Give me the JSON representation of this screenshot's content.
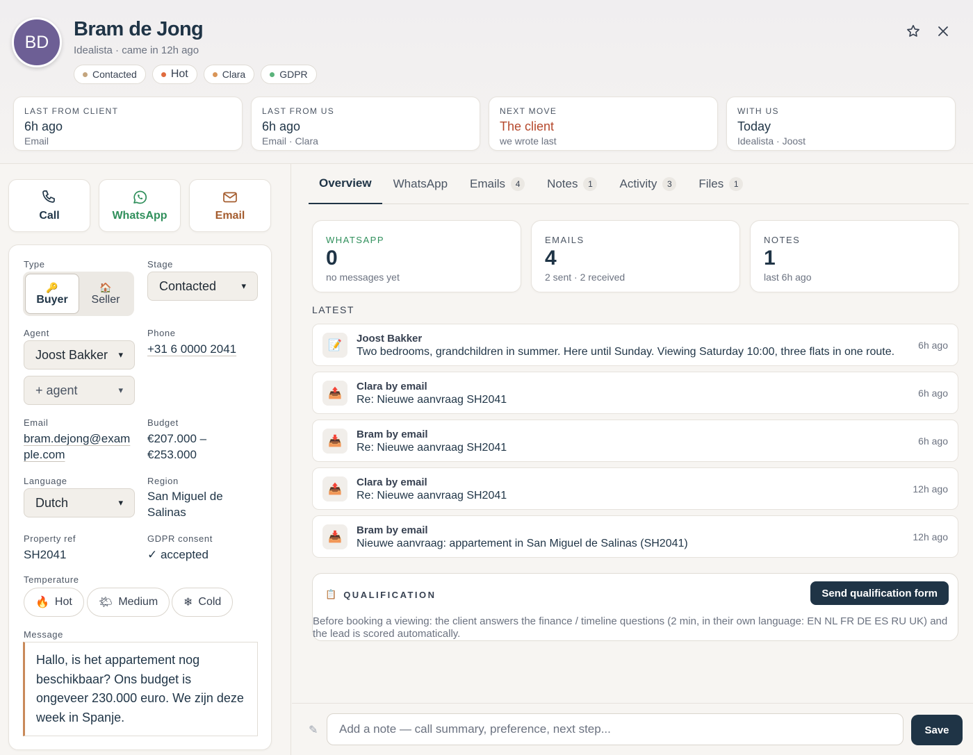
{
  "header": {
    "initials": "BD",
    "name": "Bram de Jong",
    "subtitle": "Idealista · came in 12h ago",
    "tags": [
      {
        "label": "Contacted",
        "color": "#c4a57e"
      },
      {
        "label": "Hot",
        "color": "#e06b3e"
      },
      {
        "label": "Clara",
        "color": "#d99557"
      },
      {
        "label": "GDPR",
        "color": "#5bb37b"
      }
    ]
  },
  "stats": [
    {
      "label": "LAST FROM CLIENT",
      "value": "6h ago",
      "sub": "Email"
    },
    {
      "label": "LAST FROM US",
      "value": "6h ago",
      "sub": "Email · Clara"
    },
    {
      "label": "NEXT MOVE",
      "value": "The client",
      "sub": "we wrote last"
    },
    {
      "label": "WITH US",
      "value": "Today",
      "sub": "Idealista · Joost"
    }
  ],
  "actions": {
    "call": "Call",
    "whatsapp": "WhatsApp",
    "email": "Email"
  },
  "form": {
    "type_label": "Type",
    "type_buyer": "Buyer",
    "type_seller": "Seller",
    "stage_label": "Stage",
    "stage_value": "Contacted",
    "agent_label": "Agent",
    "agent_value": "Joost Bakker",
    "add_agent": "+ agent",
    "phone_label": "Phone",
    "phone_value": "+31 6 0000 2041",
    "email_label": "Email",
    "email_line1": "bram.dejong@exam",
    "email_line2": "ple.com",
    "budget_label": "Budget",
    "budget_line1": "€207.000 –",
    "budget_line2": "€253.000",
    "language_label": "Language",
    "language_value": "Dutch",
    "region_label": "Region",
    "region_line1": "San Miguel de",
    "region_line2": "Salinas",
    "property_label": "Property ref",
    "property_value": "SH2041",
    "gdpr_label": "GDPR consent",
    "gdpr_value": "✓ accepted",
    "temperature_label": "Temperature",
    "temp_hot": "Hot",
    "temp_medium": "Medium",
    "temp_cold": "Cold",
    "message_label": "Message",
    "message": "Hallo, is het appartement nog beschikbaar? Ons budget is ongeveer 230.000 euro. We zijn deze week in Spanje."
  },
  "tabs": [
    {
      "label": "Overview",
      "count": ""
    },
    {
      "label": "WhatsApp",
      "count": ""
    },
    {
      "label": "Emails",
      "count": "4"
    },
    {
      "label": "Notes",
      "count": "1"
    },
    {
      "label": "Activity",
      "count": "3"
    },
    {
      "label": "Files",
      "count": "1"
    }
  ],
  "summary": [
    {
      "label": "WHATSAPP",
      "value": "0",
      "sub": "no messages yet"
    },
    {
      "label": "EMAILS",
      "value": "4",
      "sub": "2 sent · 2 received"
    },
    {
      "label": "NOTES",
      "value": "1",
      "sub": "last 6h ago"
    }
  ],
  "latest_label": "LATEST",
  "feed": [
    {
      "icon": "📝",
      "who": "Joost Bakker",
      "what": "Two bedrooms, grandchildren in summer. Here until Sunday. Viewing Saturday 10:00, three flats in one route.",
      "when": "6h ago"
    },
    {
      "icon": "📤",
      "who": "Clara by email",
      "what": "Re: Nieuwe aanvraag SH2041",
      "when": "6h ago"
    },
    {
      "icon": "📥",
      "who": "Bram by email",
      "what": "Re: Nieuwe aanvraag SH2041",
      "when": "6h ago"
    },
    {
      "icon": "📤",
      "who": "Clara by email",
      "what": "Re: Nieuwe aanvraag SH2041",
      "when": "12h ago"
    },
    {
      "icon": "📥",
      "who": "Bram by email",
      "what": "Nieuwe aanvraag: appartement in San Miguel de Salinas (SH2041)",
      "when": "12h ago"
    }
  ],
  "qualification": {
    "title": "QUALIFICATION",
    "button": "Send qualification form",
    "description": "Before booking a viewing: the client answers the finance / timeline questions (2 min, in their own language: EN NL FR DE ES RU UK) and the lead is scored automatically."
  },
  "note": {
    "placeholder": "Add a note — call summary, preference, next step...",
    "save": "Save"
  }
}
